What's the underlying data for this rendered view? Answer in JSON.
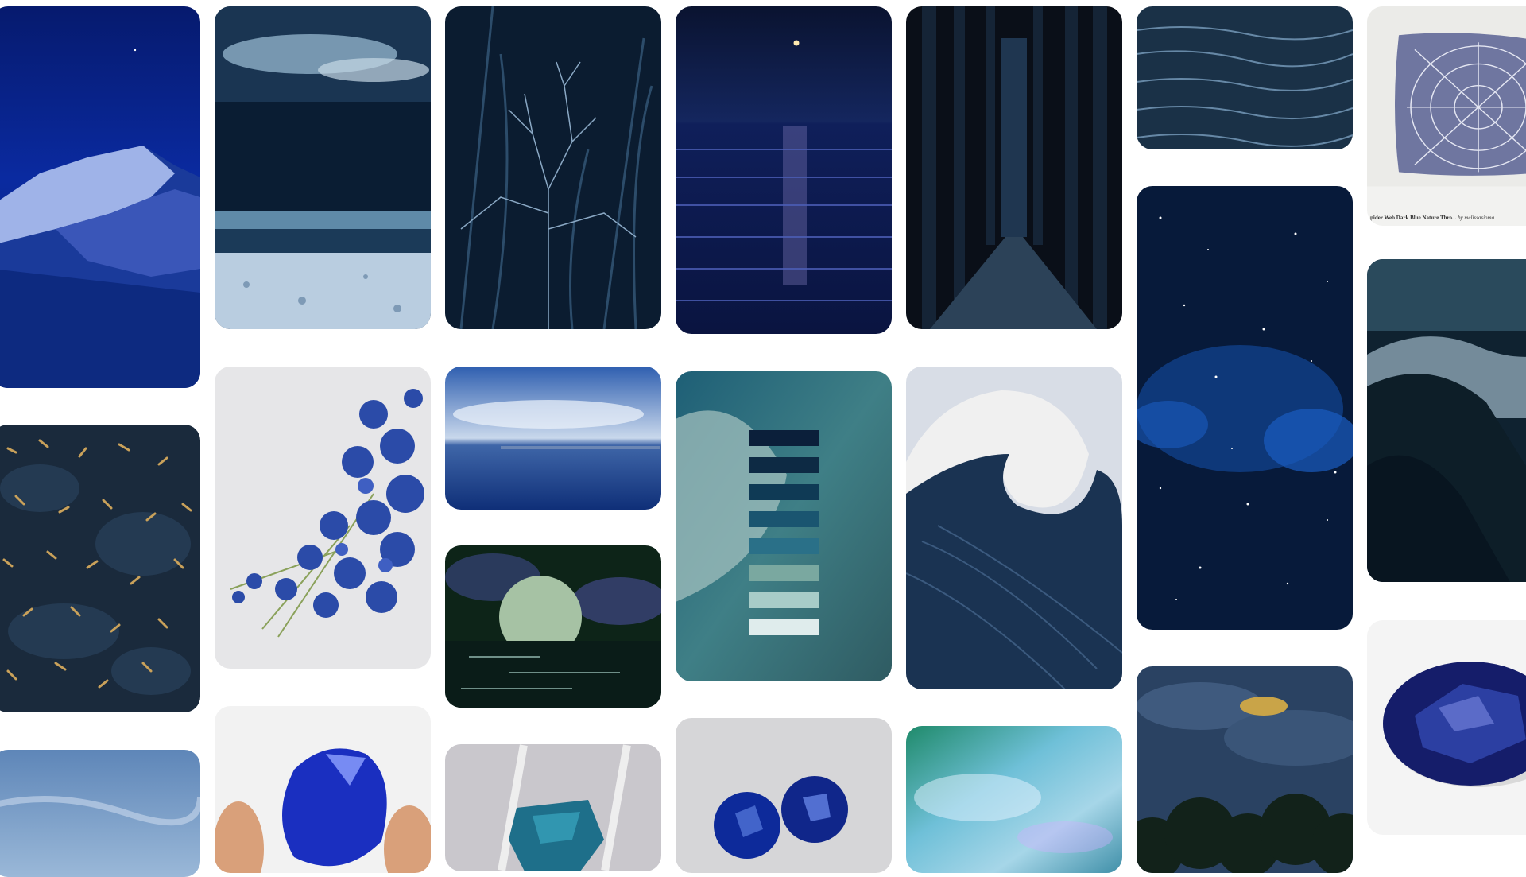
{
  "board": {
    "pins": [
      {
        "id": "night-mountain",
        "name": "pin-night-snow-mountain"
      },
      {
        "id": "stormy-sea",
        "name": "pin-stormy-sea-beach"
      },
      {
        "id": "dark-grass",
        "name": "pin-dark-grass-branches"
      },
      {
        "id": "moon-ocean",
        "name": "pin-moonlit-ocean"
      },
      {
        "id": "dark-forest",
        "name": "pin-dark-forest-path"
      },
      {
        "id": "water-ripples",
        "name": "pin-water-ripples"
      },
      {
        "id": "spider-pillow",
        "name": "pin-spider-web-pillow",
        "caption": "pider Web Dark Blue Nature Thro...",
        "caption_by": "by melissasioma"
      },
      {
        "id": "gold-leaves",
        "name": "pin-gold-leaves-on-stone"
      },
      {
        "id": "blue-flowers",
        "name": "pin-blue-flower-bouquet"
      },
      {
        "id": "blue-sky-sea",
        "name": "pin-sky-over-sea"
      },
      {
        "id": "teal-palette",
        "name": "pin-teal-color-palette"
      },
      {
        "id": "big-wave",
        "name": "pin-big-wave"
      },
      {
        "id": "galaxy",
        "name": "pin-blue-galaxy"
      },
      {
        "id": "misty-mountains",
        "name": "pin-misty-mountains"
      },
      {
        "id": "green-moon",
        "name": "pin-green-moon-reflection"
      },
      {
        "id": "sky-bottom",
        "name": "pin-light-sky"
      },
      {
        "id": "sapphire-hand",
        "name": "pin-sapphire-in-hand"
      },
      {
        "id": "tweezers-gem",
        "name": "pin-gem-in-tweezers"
      },
      {
        "id": "two-sapphires",
        "name": "pin-two-sapphires"
      },
      {
        "id": "iridescent",
        "name": "pin-iridescent-water"
      },
      {
        "id": "storm-trees",
        "name": "pin-storm-clouds-trees"
      },
      {
        "id": "oval-sapphire",
        "name": "pin-oval-sapphire"
      }
    ]
  },
  "palette": [
    "#0b1f3a",
    "#0d2a44",
    "#0f3a55",
    "#1a5570",
    "#2a7088",
    "#7aa8a0",
    "#a8ccc8",
    "#dfecec"
  ]
}
